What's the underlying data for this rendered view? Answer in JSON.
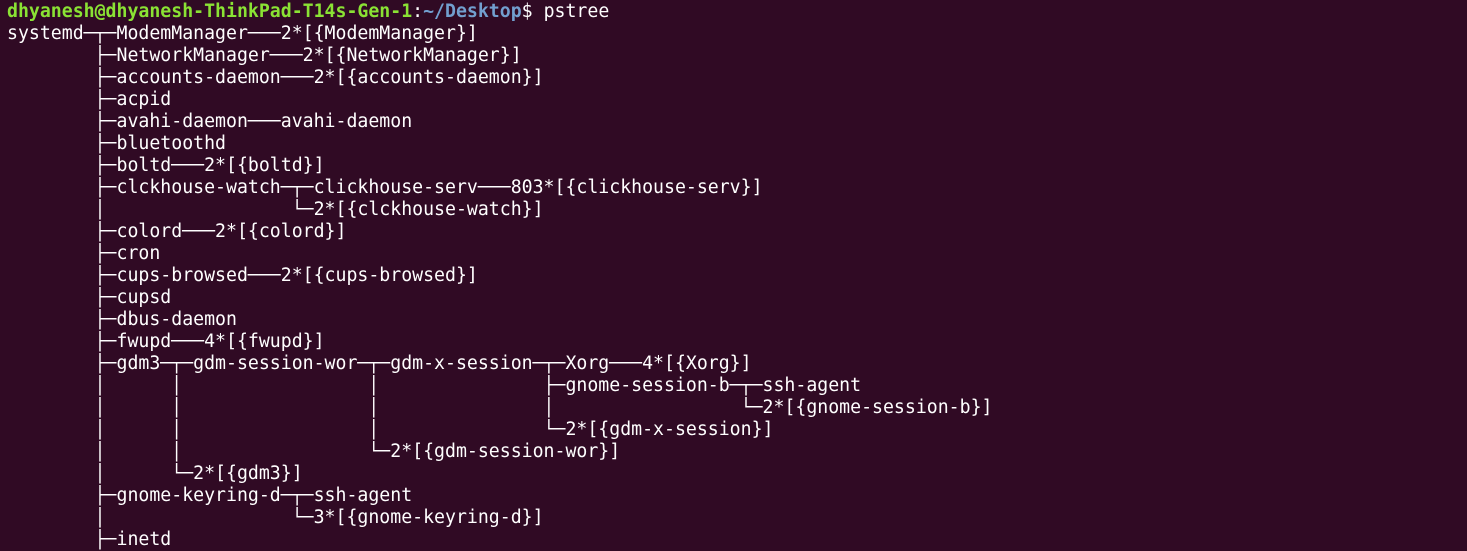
{
  "terminal": {
    "prompt": {
      "user_host": "dhyanesh@dhyanesh-ThinkPad-T14s-Gen-1",
      "separator": ":",
      "path": "~/Desktop",
      "symbol": "$ ",
      "command": "pstree"
    },
    "colors": {
      "background": "#300a24",
      "text": "#ffffff",
      "user_host": "#8ae234",
      "path": "#729fcf"
    },
    "output_lines": [
      "systemd─┬─ModemManager───2*[{ModemManager}]",
      "        ├─NetworkManager───2*[{NetworkManager}]",
      "        ├─accounts-daemon───2*[{accounts-daemon}]",
      "        ├─acpid",
      "        ├─avahi-daemon───avahi-daemon",
      "        ├─bluetoothd",
      "        ├─boltd───2*[{boltd}]",
      "        ├─clckhouse-watch─┬─clickhouse-serv───803*[{clickhouse-serv}]",
      "        │                 └─2*[{clckhouse-watch}]",
      "        ├─colord───2*[{colord}]",
      "        ├─cron",
      "        ├─cups-browsed───2*[{cups-browsed}]",
      "        ├─cupsd",
      "        ├─dbus-daemon",
      "        ├─fwupd───4*[{fwupd}]",
      "        ├─gdm3─┬─gdm-session-wor─┬─gdm-x-session─┬─Xorg───4*[{Xorg}]",
      "        │      │                 │               ├─gnome-session-b─┬─ssh-agent",
      "        │      │                 │               │                 └─2*[{gnome-session-b}]",
      "        │      │                 │               └─2*[{gdm-x-session}]",
      "        │      │                 └─2*[{gdm-session-wor}]",
      "        │      └─2*[{gdm3}]",
      "        ├─gnome-keyring-d─┬─ssh-agent",
      "        │                 └─3*[{gnome-keyring-d}]",
      "        ├─inetd"
    ]
  }
}
